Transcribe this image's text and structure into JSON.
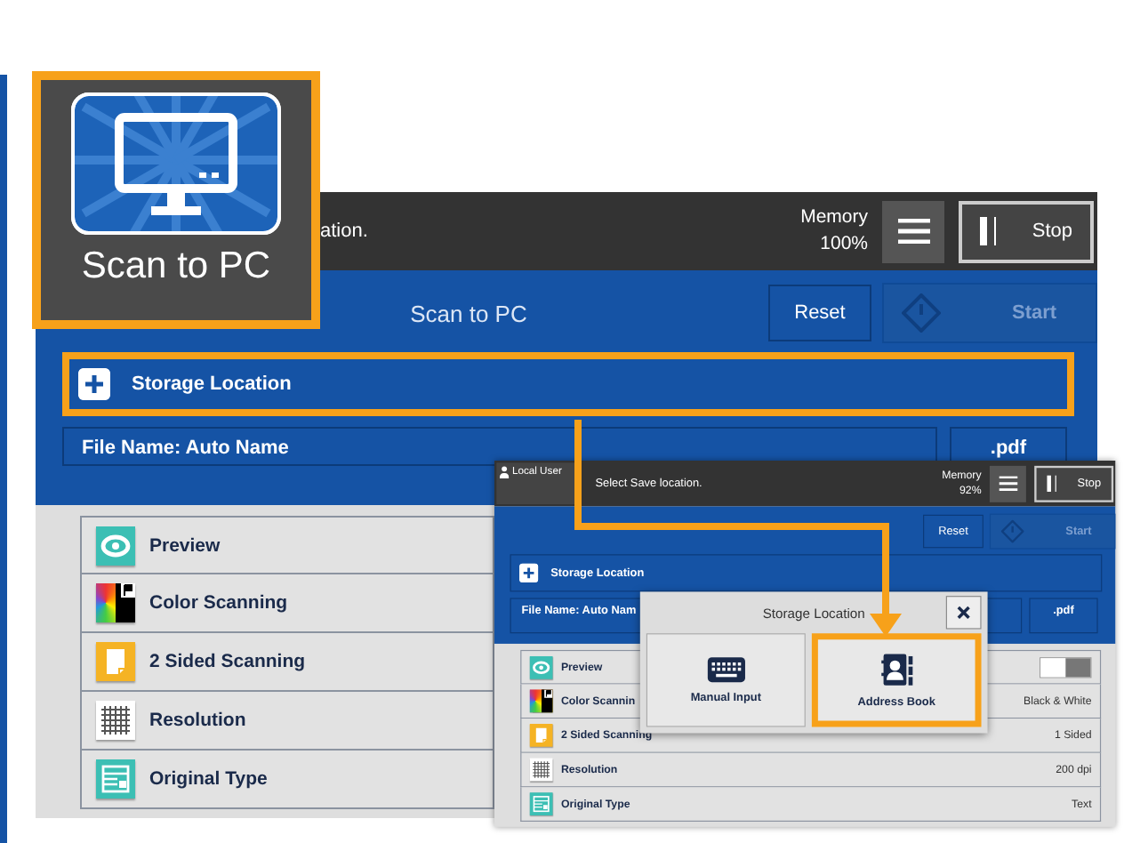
{
  "tile": {
    "label": "Scan to PC"
  },
  "main_screen": {
    "header": {
      "message": "ation.",
      "memory_label": "Memory",
      "memory_value": "100%",
      "stop_label": "Stop"
    },
    "title": "Scan to PC",
    "reset_label": "Reset",
    "start": {
      "label": "Start",
      "disabled": true
    },
    "storage_row": {
      "label": "Storage Location",
      "highlighted": true
    },
    "file_name": "File Name: Auto Name",
    "file_type": ".pdf",
    "features": [
      {
        "kind": "preview",
        "label": "Preview"
      },
      {
        "kind": "color",
        "label": "Color Scanning"
      },
      {
        "kind": "sided",
        "label": "2 Sided Scanning"
      },
      {
        "kind": "resolution",
        "label": "Resolution"
      },
      {
        "kind": "original-type",
        "label": "Original Type"
      }
    ]
  },
  "inset_screen": {
    "header": {
      "user": "Local User",
      "message": "Select Save location.",
      "memory_label": "Memory",
      "memory_value": "92%",
      "stop_label": "Stop"
    },
    "reset_label": "Reset",
    "start": {
      "label": "Start",
      "disabled": true
    },
    "storage_row": {
      "label": "Storage Location",
      "highlighted": false
    },
    "file_name": "File Name: Auto Nam",
    "file_type": ".pdf",
    "features": [
      {
        "kind": "preview",
        "label": "Preview",
        "switch": {
          "on": false
        }
      },
      {
        "kind": "color",
        "label": "Color Scannin",
        "value": "Black & White"
      },
      {
        "kind": "sided",
        "label": "2 Sided Scanning",
        "value": "1 Sided"
      },
      {
        "kind": "resolution",
        "label": "Resolution",
        "value": "200 dpi"
      },
      {
        "kind": "original-type",
        "label": "Original Type",
        "value": "Text"
      }
    ],
    "dialog": {
      "title": "Storage Location",
      "options": [
        {
          "kind": "keyboard",
          "label": "Manual Input",
          "highlighted": false
        },
        {
          "kind": "address-book",
          "label": "Address Book",
          "highlighted": true
        }
      ]
    }
  }
}
